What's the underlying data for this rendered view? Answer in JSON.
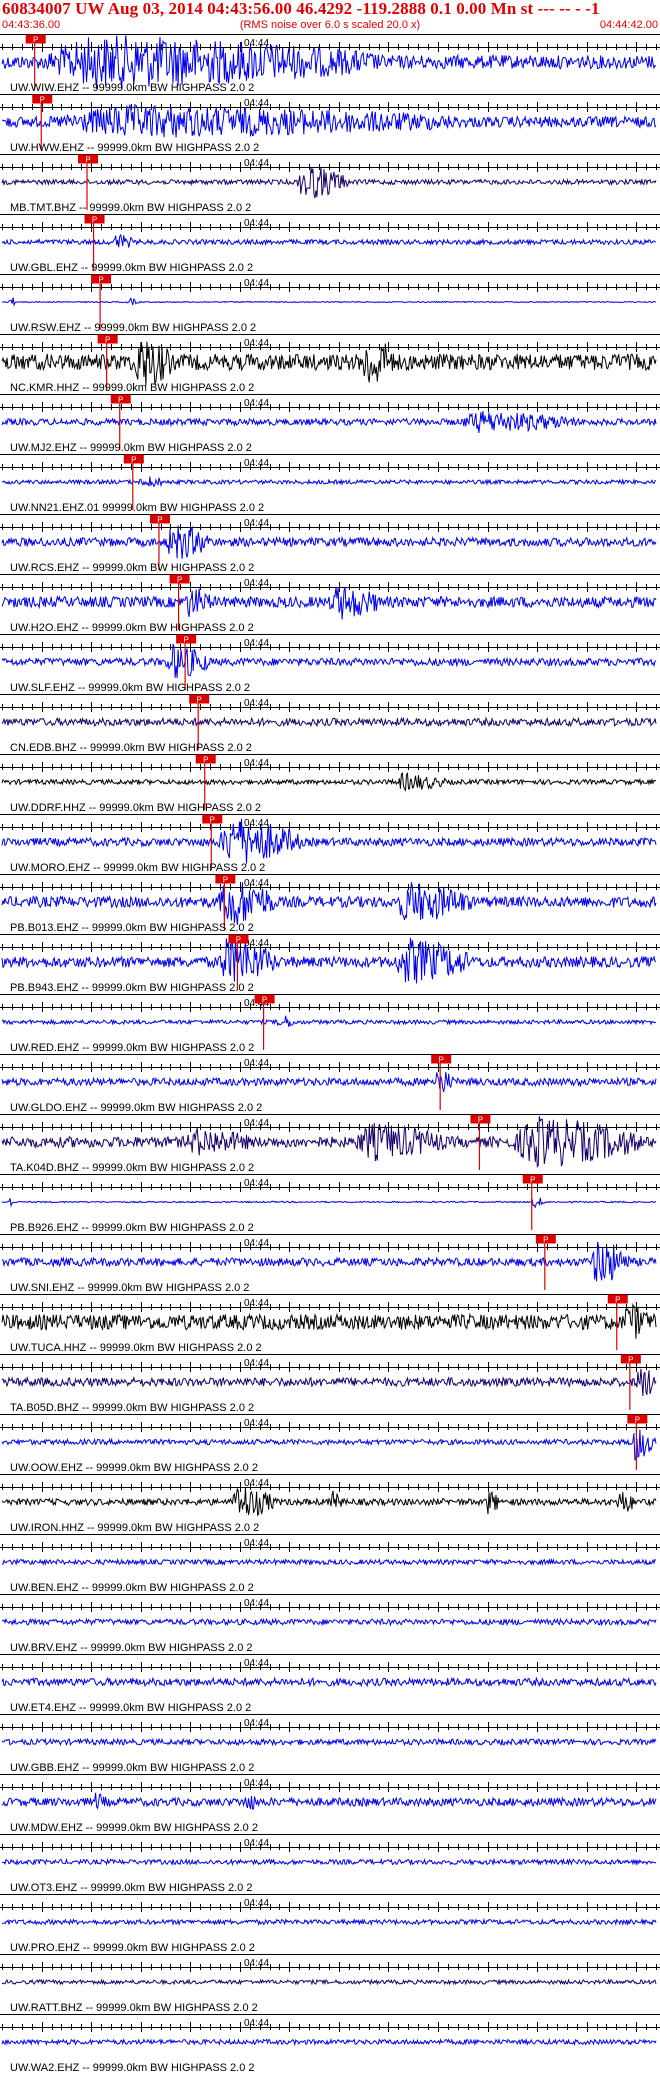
{
  "header": {
    "title": "60834007 UW Aug 03, 2014 04:43:56.00   46.4292 -119.2888  0.1 0.00 Mn st --- -- -  -1",
    "start_time": "04:43:36.00",
    "note": "(RMS noise over 6.0 s scaled 20.0 x)",
    "end_time": "04:44:42.00"
  },
  "pick_label": "P",
  "time_label": "04:44",
  "colors": {
    "blue": "#0000ee",
    "navy": "#1a006b",
    "black": "#000000",
    "pick": "#dd0000",
    "axis": "#000000"
  },
  "chart_data": {
    "type": "line",
    "title": "60834007 UW Aug 03, 2014 04:43:56.00   46.4292 -119.2888  0.1 0.00 Mn st --- -- -  -1",
    "x_range": [
      "04:43:36.00",
      "04:44:42.00"
    ],
    "x_tick_label": "04:44",
    "traces": [
      {
        "label": "UW.WIW.EHZ -- 99999.0km BW  HIGHPASS  2.0  2",
        "color": "blue",
        "pick": 0.05,
        "amp": 1.0,
        "noise": 0.25,
        "bursts": [
          [
            0.06,
            0.58,
            0.9
          ]
        ]
      },
      {
        "label": "UW.HWW.EHZ -- 99999.0km BW  HIGHPASS  2.0  2",
        "color": "blue",
        "pick": 0.06,
        "amp": 1.0,
        "noise": 0.2,
        "bursts": [
          [
            0.08,
            0.7,
            0.5
          ]
        ]
      },
      {
        "label": "MB.TMT.BHZ -- 99999.0km BW  HIGHPASS  2.0  2",
        "color": "navy",
        "pick": 0.13,
        "amp": 0.9,
        "noise": 0.1,
        "bursts": [
          [
            0.45,
            0.53,
            0.8
          ]
        ]
      },
      {
        "label": "UW.GBL.EHZ -- 99999.0km BW  HIGHPASS  2.0  2",
        "color": "blue",
        "pick": 0.14,
        "amp": 0.6,
        "noise": 0.15,
        "bursts": [
          [
            0.17,
            0.2,
            0.5
          ]
        ]
      },
      {
        "label": "UW.RSW.EHZ -- 99999.0km BW  HIGHPASS  2.0  2",
        "color": "blue",
        "pick": 0.15,
        "amp": 0.5,
        "noise": 0.04,
        "bursts": [
          [
            0.01,
            0.02,
            0.6
          ],
          [
            0.19,
            0.21,
            0.3
          ]
        ]
      },
      {
        "label": "NC.KMR.HHZ -- 99999.0km BW  HIGHPASS  2.0  2",
        "color": "black",
        "pick": 0.16,
        "amp": 1.0,
        "noise": 0.3,
        "bursts": [
          [
            0.2,
            0.26,
            0.9
          ],
          [
            0.55,
            0.6,
            0.9
          ]
        ]
      },
      {
        "label": "UW.MJ2.EHZ -- 99999.0km BW  HIGHPASS  2.0  2",
        "color": "blue",
        "pick": 0.18,
        "amp": 0.6,
        "noise": 0.2,
        "bursts": [
          [
            0.7,
            0.88,
            0.6
          ]
        ]
      },
      {
        "label": "UW.NN21.EHZ.01 99999.0km BW  HIGHPASS  2.0  2",
        "color": "blue",
        "pick": 0.2,
        "amp": 0.5,
        "noise": 0.15,
        "bursts": [
          [
            0.21,
            0.25,
            0.4
          ]
        ]
      },
      {
        "label": "UW.RCS.EHZ -- 99999.0km BW  HIGHPASS  2.0  2",
        "color": "blue",
        "pick": 0.24,
        "amp": 0.8,
        "noise": 0.2,
        "bursts": [
          [
            0.25,
            0.32,
            0.8
          ]
        ]
      },
      {
        "label": "UW.H2O.EHZ -- 99999.0km BW  HIGHPASS  2.0  2",
        "color": "blue",
        "pick": 0.27,
        "amp": 0.8,
        "noise": 0.25,
        "bursts": [
          [
            0.28,
            0.32,
            0.6
          ],
          [
            0.5,
            0.58,
            0.7
          ]
        ]
      },
      {
        "label": "UW.SLF.EHZ -- 99999.0km BW  HIGHPASS  2.0  2",
        "color": "blue",
        "pick": 0.28,
        "amp": 0.7,
        "noise": 0.2,
        "bursts": [
          [
            0.25,
            0.32,
            0.9
          ]
        ]
      },
      {
        "label": "CN.EDB.BHZ -- 99999.0km BW  HIGHPASS  2.0  2",
        "color": "navy",
        "pick": 0.3,
        "amp": 0.4,
        "noise": 0.35,
        "bursts": []
      },
      {
        "label": "UW.DDRF.HHZ -- 99999.0km BW  HIGHPASS  2.0  2",
        "color": "black",
        "pick": 0.31,
        "amp": 0.6,
        "noise": 0.15,
        "bursts": [
          [
            0.6,
            0.68,
            0.5
          ]
        ]
      },
      {
        "label": "UW.MORO.EHZ -- 99999.0km BW  HIGHPASS  2.0  2",
        "color": "blue",
        "pick": 0.32,
        "amp": 1.0,
        "noise": 0.15,
        "bursts": [
          [
            0.33,
            0.46,
            0.9
          ]
        ]
      },
      {
        "label": "PB.B013.EHZ -- 99999.0km BW  HIGHPASS  2.0  2",
        "color": "blue",
        "pick": 0.34,
        "amp": 1.0,
        "noise": 0.2,
        "bursts": [
          [
            0.33,
            0.42,
            0.9
          ],
          [
            0.6,
            0.72,
            0.7
          ]
        ]
      },
      {
        "label": "PB.B943.EHZ -- 99999.0km BW  HIGHPASS  2.0  2",
        "color": "blue",
        "pick": 0.36,
        "amp": 1.0,
        "noise": 0.2,
        "bursts": [
          [
            0.33,
            0.42,
            0.9
          ],
          [
            0.6,
            0.72,
            0.8
          ]
        ]
      },
      {
        "label": "UW.RED.EHZ -- 99999.0km BW  HIGHPASS  2.0  2",
        "color": "blue",
        "pick": 0.4,
        "amp": 0.5,
        "noise": 0.15,
        "bursts": [
          [
            0.42,
            0.45,
            0.5
          ]
        ]
      },
      {
        "label": "UW.GLDO.EHZ -- 99999.0km BW  HIGHPASS  2.0  2",
        "color": "blue",
        "pick": 0.67,
        "amp": 0.7,
        "noise": 0.2,
        "bursts": [
          [
            0.66,
            0.69,
            0.7
          ]
        ]
      },
      {
        "label": "TA.K04D.BHZ -- 99999.0km BW  HIGHPASS  2.0  2",
        "color": "navy",
        "pick": 0.73,
        "amp": 1.0,
        "noise": 0.2,
        "bursts": [
          [
            0.28,
            0.38,
            0.4
          ],
          [
            0.54,
            0.68,
            0.6
          ],
          [
            0.78,
            0.98,
            0.9
          ]
        ]
      },
      {
        "label": "PB.B926.EHZ -- 99999.0km BW  HIGHPASS  2.0  2",
        "color": "blue",
        "pick": 0.81,
        "amp": 0.5,
        "noise": 0.05,
        "bursts": [
          [
            0.01,
            0.02,
            0.5
          ],
          [
            0.81,
            0.83,
            0.5
          ]
        ]
      },
      {
        "label": "UW.SNI.EHZ -- 99999.0km BW  HIGHPASS  2.0  2",
        "color": "blue",
        "pick": 0.83,
        "amp": 1.0,
        "noise": 0.15,
        "bursts": [
          [
            0.9,
            0.96,
            0.9
          ]
        ]
      },
      {
        "label": "UW.TUCA.HHZ -- 99999.0km BW  HIGHPASS  2.0  2",
        "color": "black",
        "pick": 0.94,
        "amp": 0.8,
        "noise": 0.35,
        "bursts": [
          [
            0.95,
            0.99,
            0.7
          ]
        ]
      },
      {
        "label": "TA.B05D.BHZ -- 99999.0km BW  HIGHPASS  2.0  2",
        "color": "navy",
        "pick": 0.96,
        "amp": 0.8,
        "noise": 0.2,
        "bursts": [
          [
            0.97,
            1.0,
            0.8
          ]
        ]
      },
      {
        "label": "UW.OOW.EHZ -- 99999.0km BW  HIGHPASS  2.0  2",
        "color": "blue",
        "pick": 0.97,
        "amp": 0.8,
        "noise": 0.12,
        "bursts": [
          [
            0.96,
            1.0,
            0.9
          ]
        ]
      },
      {
        "label": "UW.IRON.HHZ -- 99999.0km BW  HIGHPASS  2.0  2",
        "color": "black",
        "pick": null,
        "amp": 0.8,
        "noise": 0.15,
        "bursts": [
          [
            0.35,
            0.42,
            0.8
          ],
          [
            0.5,
            0.52,
            0.6
          ],
          [
            0.74,
            0.76,
            0.6
          ],
          [
            0.94,
            0.97,
            0.5
          ]
        ]
      },
      {
        "label": "UW.BEN.EHZ -- 99999.0km BW  HIGHPASS  2.0  2",
        "color": "blue",
        "pick": null,
        "amp": 0.3,
        "noise": 0.3,
        "bursts": []
      },
      {
        "label": "UW.BRV.EHZ -- 99999.0km BW  HIGHPASS  2.0  2",
        "color": "blue",
        "pick": null,
        "amp": 0.35,
        "noise": 0.3,
        "bursts": []
      },
      {
        "label": "UW.ET4.EHZ -- 99999.0km BW  HIGHPASS  2.0  2",
        "color": "blue",
        "pick": null,
        "amp": 0.4,
        "noise": 0.35,
        "bursts": []
      },
      {
        "label": "UW.GBB.EHZ -- 99999.0km BW  HIGHPASS  2.0  2",
        "color": "blue",
        "pick": null,
        "amp": 0.35,
        "noise": 0.3,
        "bursts": []
      },
      {
        "label": "UW.MDW.EHZ -- 99999.0km BW  HIGHPASS  2.0  2",
        "color": "blue",
        "pick": null,
        "amp": 0.5,
        "noise": 0.3,
        "bursts": [
          [
            0.14,
            0.16,
            0.5
          ],
          [
            0.37,
            0.39,
            0.6
          ]
        ]
      },
      {
        "label": "UW.OT3.EHZ -- 99999.0km BW  HIGHPASS  2.0  2",
        "color": "blue",
        "pick": null,
        "amp": 0.3,
        "noise": 0.3,
        "bursts": []
      },
      {
        "label": "UW.PRO.EHZ -- 99999.0km BW  HIGHPASS  2.0  2",
        "color": "blue",
        "pick": null,
        "amp": 0.25,
        "noise": 0.35,
        "bursts": []
      },
      {
        "label": "UW.RATT.BHZ -- 99999.0km BW  HIGHPASS  2.0  2",
        "color": "navy",
        "pick": null,
        "amp": 0.25,
        "noise": 0.3,
        "bursts": []
      },
      {
        "label": "UW.WA2.EHZ -- 99999.0km BW  HIGHPASS  2.0  2",
        "color": "blue",
        "pick": null,
        "amp": 0.3,
        "noise": 0.3,
        "bursts": []
      }
    ]
  }
}
